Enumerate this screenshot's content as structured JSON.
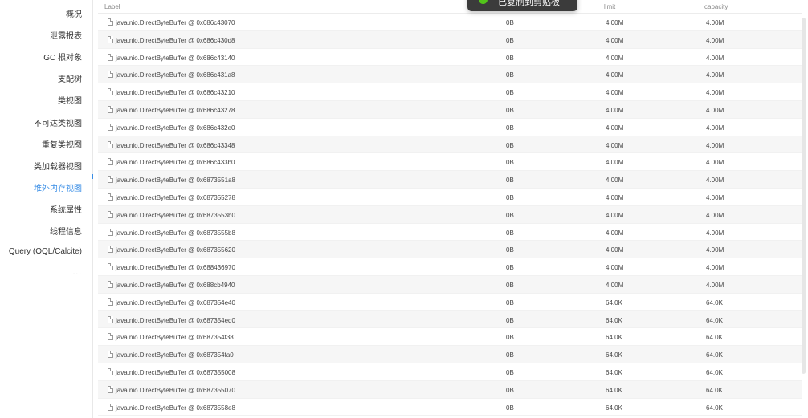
{
  "sidebar": {
    "items": [
      {
        "label": "概况"
      },
      {
        "label": "泄露报表"
      },
      {
        "label": "GC 根对象"
      },
      {
        "label": "支配树"
      },
      {
        "label": "类视图"
      },
      {
        "label": "不可达类视图"
      },
      {
        "label": "重复类视图"
      },
      {
        "label": "类加载器视图"
      },
      {
        "label": "堆外内存视图",
        "active": true
      },
      {
        "label": "系统属性"
      },
      {
        "label": "线程信息"
      },
      {
        "label": "Query (OQL/Calcite)"
      }
    ],
    "more": "..."
  },
  "table": {
    "columns": {
      "label": "Label",
      "limit": "limit",
      "capacity": "capacity"
    },
    "rows": [
      {
        "label": "java.nio.DirectByteBuffer @ 0x686c43070",
        "position": "0B",
        "limit": "4.00M",
        "capacity": "4.00M"
      },
      {
        "label": "java.nio.DirectByteBuffer @ 0x686c430d8",
        "position": "0B",
        "limit": "4.00M",
        "capacity": "4.00M"
      },
      {
        "label": "java.nio.DirectByteBuffer @ 0x686c43140",
        "position": "0B",
        "limit": "4.00M",
        "capacity": "4.00M"
      },
      {
        "label": "java.nio.DirectByteBuffer @ 0x686c431a8",
        "position": "0B",
        "limit": "4.00M",
        "capacity": "4.00M"
      },
      {
        "label": "java.nio.DirectByteBuffer @ 0x686c43210",
        "position": "0B",
        "limit": "4.00M",
        "capacity": "4.00M"
      },
      {
        "label": "java.nio.DirectByteBuffer @ 0x686c43278",
        "position": "0B",
        "limit": "4.00M",
        "capacity": "4.00M"
      },
      {
        "label": "java.nio.DirectByteBuffer @ 0x686c432e0",
        "position": "0B",
        "limit": "4.00M",
        "capacity": "4.00M"
      },
      {
        "label": "java.nio.DirectByteBuffer @ 0x686c43348",
        "position": "0B",
        "limit": "4.00M",
        "capacity": "4.00M"
      },
      {
        "label": "java.nio.DirectByteBuffer @ 0x686c433b0",
        "position": "0B",
        "limit": "4.00M",
        "capacity": "4.00M"
      },
      {
        "label": "java.nio.DirectByteBuffer @ 0x6873551a8",
        "position": "0B",
        "limit": "4.00M",
        "capacity": "4.00M"
      },
      {
        "label": "java.nio.DirectByteBuffer @ 0x687355278",
        "position": "0B",
        "limit": "4.00M",
        "capacity": "4.00M"
      },
      {
        "label": "java.nio.DirectByteBuffer @ 0x6873553b0",
        "position": "0B",
        "limit": "4.00M",
        "capacity": "4.00M"
      },
      {
        "label": "java.nio.DirectByteBuffer @ 0x6873555b8",
        "position": "0B",
        "limit": "4.00M",
        "capacity": "4.00M"
      },
      {
        "label": "java.nio.DirectByteBuffer @ 0x687355620",
        "position": "0B",
        "limit": "4.00M",
        "capacity": "4.00M"
      },
      {
        "label": "java.nio.DirectByteBuffer @ 0x688436970",
        "position": "0B",
        "limit": "4.00M",
        "capacity": "4.00M"
      },
      {
        "label": "java.nio.DirectByteBuffer @ 0x688cb4940",
        "position": "0B",
        "limit": "4.00M",
        "capacity": "4.00M"
      },
      {
        "label": "java.nio.DirectByteBuffer @ 0x687354e40",
        "position": "0B",
        "limit": "64.0K",
        "capacity": "64.0K"
      },
      {
        "label": "java.nio.DirectByteBuffer @ 0x687354ed0",
        "position": "0B",
        "limit": "64.0K",
        "capacity": "64.0K"
      },
      {
        "label": "java.nio.DirectByteBuffer @ 0x687354f38",
        "position": "0B",
        "limit": "64.0K",
        "capacity": "64.0K"
      },
      {
        "label": "java.nio.DirectByteBuffer @ 0x687354fa0",
        "position": "0B",
        "limit": "64.0K",
        "capacity": "64.0K"
      },
      {
        "label": "java.nio.DirectByteBuffer @ 0x687355008",
        "position": "0B",
        "limit": "64.0K",
        "capacity": "64.0K"
      },
      {
        "label": "java.nio.DirectByteBuffer @ 0x687355070",
        "position": "0B",
        "limit": "64.0K",
        "capacity": "64.0K"
      },
      {
        "label": "java.nio.DirectByteBuffer @ 0x6873558e8",
        "position": "0B",
        "limit": "64.0K",
        "capacity": "64.0K"
      }
    ]
  },
  "toast": {
    "message": "已复制到剪贴板",
    "icon": "check-circle-icon"
  },
  "colors": {
    "accent": "#3a8ee6",
    "toast_bg": "#3b3b3b",
    "success": "#52c41a"
  }
}
